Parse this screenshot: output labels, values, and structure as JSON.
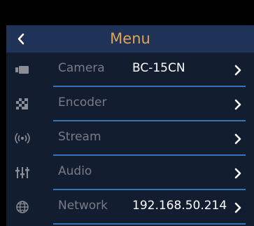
{
  "header": {
    "title": "Menu",
    "back_icon": "chevron-left-icon"
  },
  "menu": [
    {
      "id": "camera",
      "label": "Camera",
      "value": "BC-15CN",
      "icon": "camera-icon"
    },
    {
      "id": "encoder",
      "label": "Encoder",
      "value": "",
      "icon": "encoder-icon"
    },
    {
      "id": "stream",
      "label": "Stream",
      "value": "",
      "icon": "stream-icon"
    },
    {
      "id": "audio",
      "label": "Audio",
      "value": "",
      "icon": "audio-mixer-icon"
    },
    {
      "id": "network",
      "label": "Network",
      "value": "192.168.50.214",
      "icon": "globe-icon"
    }
  ],
  "colors": {
    "header_bg": "#1f3358",
    "screen_bg": "#121d2f",
    "title": "#e0a455",
    "divider": "#3a72b6",
    "label": "#7b7b86",
    "value": "#ffffff"
  }
}
